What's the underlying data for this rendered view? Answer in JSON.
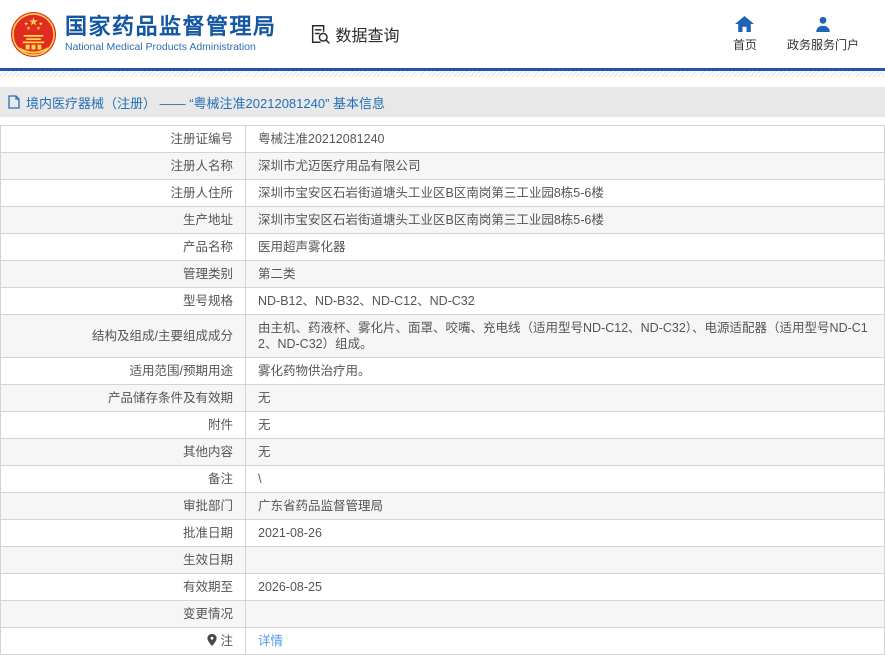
{
  "header": {
    "org_name_cn": "国家药品监督管理局",
    "org_name_en": "National Medical Products Administration",
    "data_query_label": "数据查询",
    "nav": [
      {
        "label": "首页",
        "icon": "home-icon"
      },
      {
        "label": "政务服务门户",
        "icon": "user-icon"
      }
    ]
  },
  "title_bar": {
    "icon": "document-icon",
    "text": "境内医疗器械（注册） —— “粤械注准20212081240” 基本信息"
  },
  "table": {
    "rows": [
      {
        "label": "注册证编号",
        "value": "粤械注准20212081240"
      },
      {
        "label": "注册人名称",
        "value": "深圳市尤迈医疗用品有限公司"
      },
      {
        "label": "注册人住所",
        "value": "深圳市宝安区石岩街道塘头工业区B区南岗第三工业园8栋5-6楼"
      },
      {
        "label": "生产地址",
        "value": "深圳市宝安区石岩街道塘头工业区B区南岗第三工业园8栋5-6楼"
      },
      {
        "label": "产品名称",
        "value": "医用超声雾化器"
      },
      {
        "label": "管理类别",
        "value": "第二类"
      },
      {
        "label": "型号规格",
        "value": "ND-B12、ND-B32、ND-C12、ND-C32"
      },
      {
        "label": "结构及组成/主要组成成分",
        "value": "由主机、药液杯、雾化片、面罩、咬嘴、充电线（适用型号ND-C12、ND-C32）、电源适配器（适用型号ND-C12、ND-C32）组成。"
      },
      {
        "label": "适用范围/预期用途",
        "value": "雾化药物供治疗用。"
      },
      {
        "label": "产品储存条件及有效期",
        "value": "无"
      },
      {
        "label": "附件",
        "value": "无"
      },
      {
        "label": "其他内容",
        "value": "无"
      },
      {
        "label": "备注",
        "value": "\\"
      },
      {
        "label": "审批部门",
        "value": "广东省药品监督管理局"
      },
      {
        "label": "批准日期",
        "value": "2021-08-26"
      },
      {
        "label": "生效日期",
        "value": ""
      },
      {
        "label": "有效期至",
        "value": "2026-08-25"
      },
      {
        "label": "变更情况",
        "value": ""
      },
      {
        "label": "注",
        "value": "详情",
        "link": true,
        "icon": "pin-icon"
      }
    ]
  },
  "colors": {
    "brand_blue": "#1356a2",
    "nav_icon_blue": "#2063b4",
    "title_text_blue": "#2470b8",
    "link_blue": "#4f9be8",
    "emblem_red": "#e02b20",
    "emblem_gold": "#ffd34d",
    "title_bar_bg": "#e8e8e8",
    "row_alt_bg": "#f6f6f6"
  }
}
